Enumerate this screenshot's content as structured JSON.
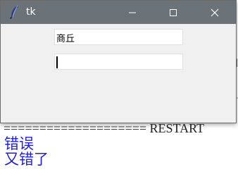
{
  "window": {
    "title": "tk",
    "controls": {
      "minimize": "minimize",
      "maximize": "maximize",
      "close": "close"
    }
  },
  "form": {
    "entry1_value": "商丘",
    "entry2_value": ""
  },
  "shell": {
    "restart_line": "==================== RESTART",
    "output_lines": [
      "错误",
      "又错了"
    ]
  },
  "colors": {
    "titlebar": "#6b7378",
    "window_bg": "#f0f0f0",
    "shell_output": "#2222cc"
  },
  "icons": [
    "feather-icon",
    "minimize-icon",
    "maximize-icon",
    "close-icon"
  ]
}
